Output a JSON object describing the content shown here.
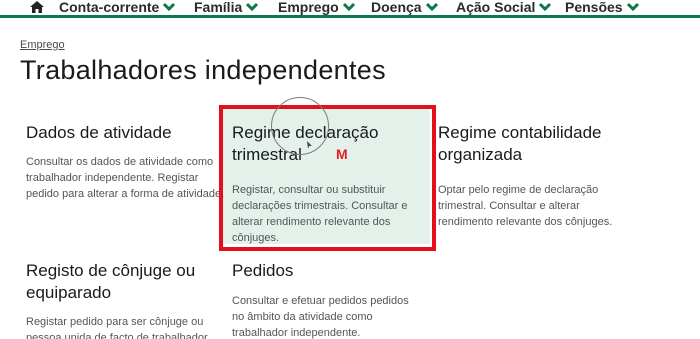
{
  "nav": {
    "items": [
      {
        "label": "Conta-corrente"
      },
      {
        "label": "Família"
      },
      {
        "label": "Emprego"
      },
      {
        "label": "Doença"
      },
      {
        "label": "Ação Social"
      },
      {
        "label": "Pensões"
      }
    ],
    "accent_color": "#0b7a4b"
  },
  "breadcrumb": "Emprego",
  "page_title": "Trabalhadores independentes",
  "cards": [
    {
      "title": "Dados de atividade",
      "text": "Consultar os dados de atividade como trabalhador independente. Registar pedido para alterar a forma de atividade."
    },
    {
      "title": "Regime declaração trimestral",
      "text": "Registar, consultar ou substituir declarações trimestrais. Consultar e alterar rendimento relevante dos cônjuges."
    },
    {
      "title": "Regime contabilidade organizada",
      "text": "Optar pelo regime de declaração trimestral. Consultar e alterar rendimento relevante dos cônjuges."
    },
    {
      "title": "Registo de cônjuge ou equiparado",
      "text": "Registar pedido para ser cônjuge ou pessoa unida de facto de trabalhador"
    },
    {
      "title": "Pedidos",
      "text": "Consultar e efetuar pedidos pedidos no âmbito da atividade como trabalhador independente."
    }
  ],
  "annotation_mark": "M",
  "highlight_color": "#e3101a"
}
